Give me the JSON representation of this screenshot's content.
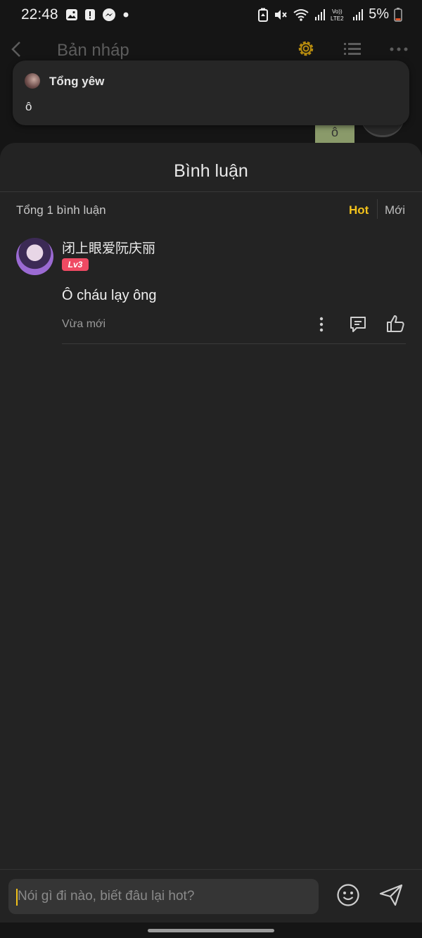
{
  "status_bar": {
    "time": "22:48",
    "battery": "5%",
    "network_label": "VoLTE2",
    "left_icons": [
      "gallery-icon",
      "alert-icon",
      "messenger-icon",
      "dot-icon"
    ],
    "right_icons": [
      "recycle-icon",
      "mute-icon",
      "wifi-icon",
      "signal-icon",
      "signal-icon",
      "battery-icon"
    ]
  },
  "app_bar": {
    "title": "Bản nháp",
    "accent_color": "#b58a0e"
  },
  "notification": {
    "sender": "Tổng yêw",
    "message": "ô"
  },
  "background_fragment": {
    "tile_text": "ô"
  },
  "comments_sheet": {
    "title": "Bình luận",
    "total_label": "Tổng 1 bình luận",
    "sort_options": {
      "hot": "Hot",
      "new": "Mới",
      "active": "hot",
      "active_color": "#f2c21b"
    },
    "comments": [
      {
        "author": "闭上眼爱阮庆丽",
        "level": "Lv3",
        "level_color": "#ef4a63",
        "text": "Ô cháu lạy ông",
        "time": "Vừa mới"
      }
    ]
  },
  "input": {
    "placeholder": "Nói gì đi nào, biết đâu lại hot?"
  }
}
